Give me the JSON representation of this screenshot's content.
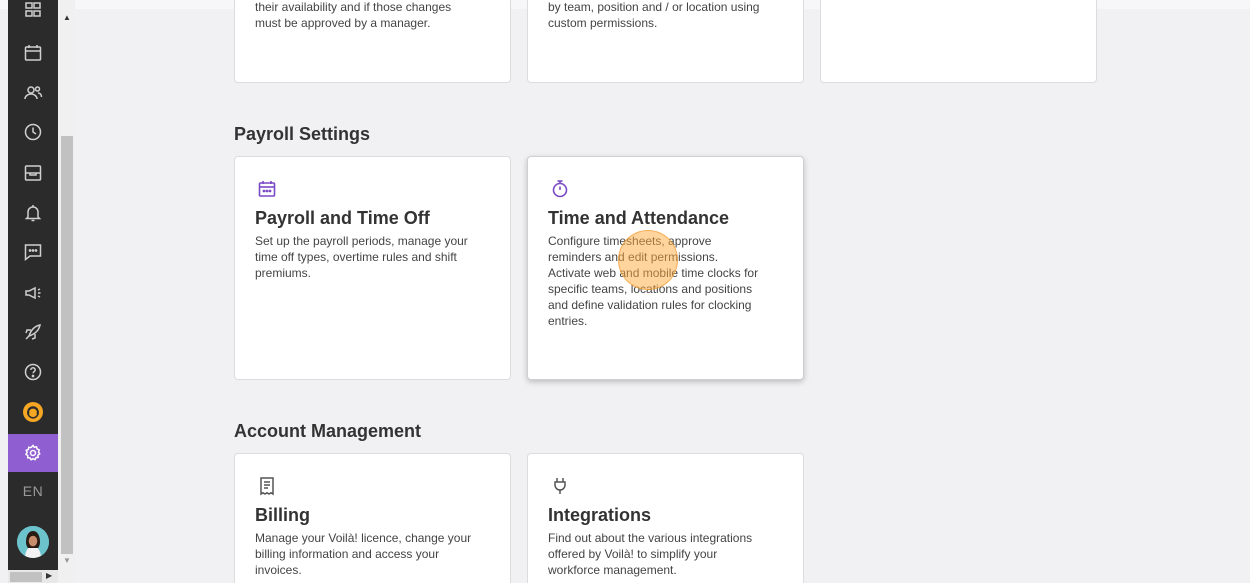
{
  "sidebar": {
    "language": "EN",
    "icons": [
      "apps-icon",
      "calendar-icon",
      "people-icon",
      "clock-icon",
      "inbox-icon",
      "bell-icon",
      "chat-icon",
      "megaphone-icon",
      "rocket-icon",
      "help-icon",
      "support-icon",
      "settings-icon"
    ],
    "active_color": "#8f5fd1"
  },
  "top_cards": [
    {
      "desc_line1": "their availability and if those changes",
      "desc_line2": "must be approved by a manager."
    },
    {
      "desc_line1": "by team, position and / or location using",
      "desc_line2": "custom permissions."
    },
    {
      "desc_line1": "",
      "desc_line2": ""
    }
  ],
  "payroll": {
    "section_title": "Payroll Settings",
    "cards": [
      {
        "icon": "calendar-icon",
        "title": "Payroll and Time Off",
        "desc": [
          "Set up the payroll periods, manage your",
          "time off types, overtime rules and shift",
          "premiums."
        ]
      },
      {
        "icon": "stopwatch-icon",
        "title": "Time and Attendance",
        "desc": [
          "Configure timesheets, approve",
          "reminders and edit permissions.",
          "Activate web and mobile time clocks for",
          "specific teams, locations and positions",
          "and define validation rules for clocking",
          "entries."
        ]
      }
    ]
  },
  "account": {
    "section_title": "Account Management",
    "cards": [
      {
        "icon": "receipt-icon",
        "title": "Billing",
        "desc": [
          "Manage your Voilà! licence, change your",
          "billing information and access your",
          "invoices."
        ]
      },
      {
        "icon": "plug-icon",
        "title": "Integrations",
        "desc": [
          "Find out about the various integrations",
          "offered by Voilà! to simplify your",
          "workforce management."
        ]
      }
    ]
  },
  "accent_color": "#7a49c6"
}
